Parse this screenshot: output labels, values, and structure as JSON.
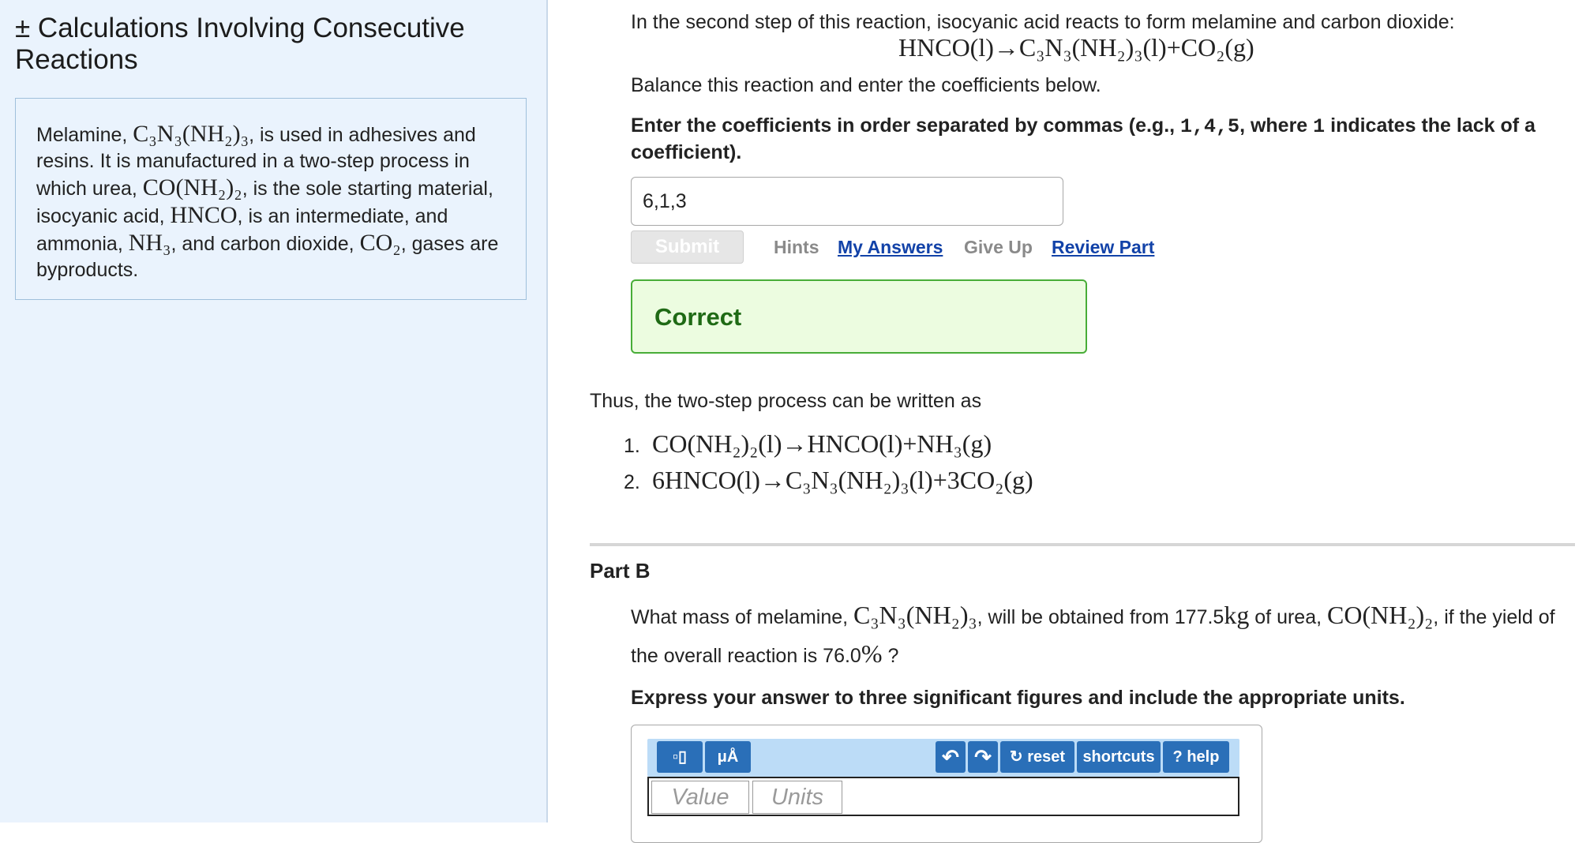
{
  "sidebar": {
    "title": "± Calculations Involving Consecutive Reactions",
    "intro": {
      "t1": "Melamine, ",
      "m1": "C₃N₃(NH₂)₃",
      "t2": ", is used in adhesives and resins. It is manufactured in a two-step process in which urea, ",
      "m2": "CO(NH₂)₂",
      "t3": ", is the sole starting material, isocyanic acid, ",
      "m3": "HNCO",
      "t4": ", is an intermediate, and ammonia, ",
      "m4": "NH₃",
      "t5": ", and carbon dioxide, ",
      "m5": "CO₂",
      "t6": ", gases are byproducts."
    }
  },
  "part_a": {
    "prompt": "In the second step of this reaction, isocyanic acid reacts to form melamine and carbon dioxide:",
    "reaction": "HNCO(l)→C₃N₃(NH₂)₃(l)+CO₂(g)",
    "balance_instruction": "Balance this reaction and enter the coefficients below.",
    "entry_instruction": {
      "t1": "Enter the coefficients in order separated by commas (e.g., ",
      "code1": "1,4,5",
      "t2": ", where ",
      "code2": "1",
      "t3": " indicates the lack of a coefficient)."
    },
    "answer_value": "6,1,3",
    "actions": {
      "submit": "Submit",
      "hints": "Hints",
      "my_answers": "My Answers",
      "give_up": "Give Up",
      "review_part": "Review Part"
    },
    "feedback": "Correct"
  },
  "summary": {
    "lead": "Thus, the two-step process can be written as",
    "steps": [
      {
        "num": "1.",
        "eq": "CO(NH₂)₂(l)→HNCO(l)+NH₃(g)"
      },
      {
        "num": "2.",
        "eq": "6HNCO(l)→C₃N₃(NH₂)₃(l)+3CO₂(g)"
      }
    ]
  },
  "part_b": {
    "heading": "Part B",
    "question": {
      "t1": "What mass of melamine, ",
      "m1": "C₃N₃(NH₂)₃",
      "t2": ", will be obtained from 177.5",
      "m2": "kg",
      "t3": " of urea, ",
      "m3": "CO(NH₂)₂",
      "t4": ", if the yield of the overall reaction is 76.0",
      "m4": "%",
      "t5": " ?"
    },
    "instruction": "Express your answer to three significant figures and include the appropriate units.",
    "toolbar": {
      "templates": "▫▯",
      "units": "μÅ",
      "undo": "↶",
      "redo": "↷",
      "reset": "↻ reset",
      "shortcuts": "shortcuts",
      "help": "? help"
    },
    "value_placeholder": "Value",
    "units_placeholder": "Units"
  }
}
